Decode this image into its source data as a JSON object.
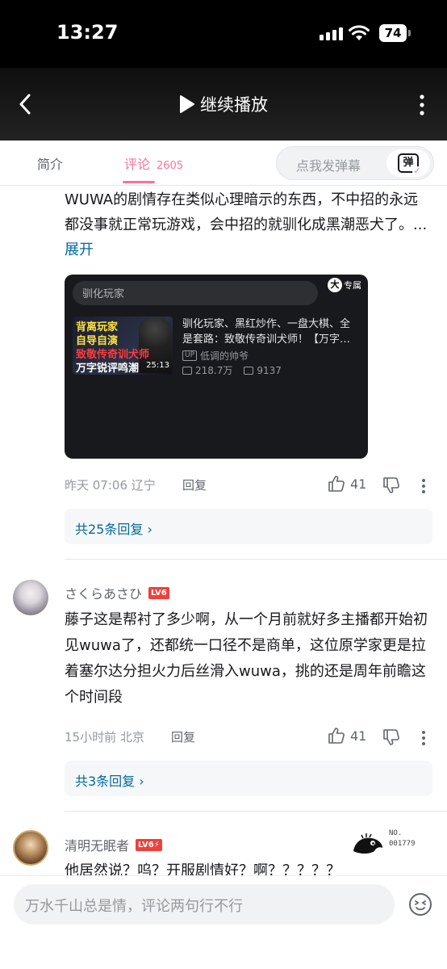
{
  "status_bar": {
    "time": "13:27",
    "battery": "74"
  },
  "header": {
    "continue_label": "继续播放"
  },
  "tabs": {
    "intro": "简介",
    "comments": "评论",
    "comments_count": "2605"
  },
  "danmaku": {
    "placeholder": "点我发弹幕",
    "button_label": "弹"
  },
  "comments": [
    {
      "text": "WUWA的剧情存在类似心理暗示的东西，不中招的永远都没事就正常玩游戏，会中招的就驯化成黑潮恶犬了。...",
      "expand": "展开",
      "video_card": {
        "search": "驯化玩家",
        "exclusive_badge": "大",
        "exclusive_label": "专属",
        "thumb_lines": [
          "背离玩家",
          "自导自演",
          "致敬传奇训犬师",
          "万字锐评鸣潮"
        ],
        "duration": "25:13",
        "title": "驯化玩家、黑红炒作、一盘大棋、全是套路：致敬传奇训犬师！【万字…",
        "up_tag": "UP",
        "uploader": "低调的帅爷",
        "views": "218.7万",
        "danmaku_count": "9137"
      },
      "meta": "昨天 07:06 辽宁",
      "reply_label": "回复",
      "likes": "41",
      "replies_link": "共25条回复"
    },
    {
      "user": "さくらあさひ",
      "level": "LV6",
      "text": "藤子这是帮衬了多少啊，从一个月前就好多主播都开始初见wuwa了，还都统一口径不是商单，这位原学家更是拉着塞尔达分担火力后丝滑入wuwa，挑的还是周年前瞻这个时间段",
      "meta": "15小时前 北京",
      "reply_label": "回复",
      "likes": "41",
      "replies_link": "共3条回复"
    },
    {
      "user": "清明无眠者",
      "level": "LV6⚡",
      "fan_badge": "NO.\n001779",
      "text": "他居然说？呜？开服剧情好？啊？？？？？"
    }
  ],
  "bottom_input": {
    "placeholder": "万水千山总是情，评论两句行不行"
  },
  "colors": {
    "accent": "#fb7299",
    "link": "#00699d",
    "level": "#f0403a"
  }
}
